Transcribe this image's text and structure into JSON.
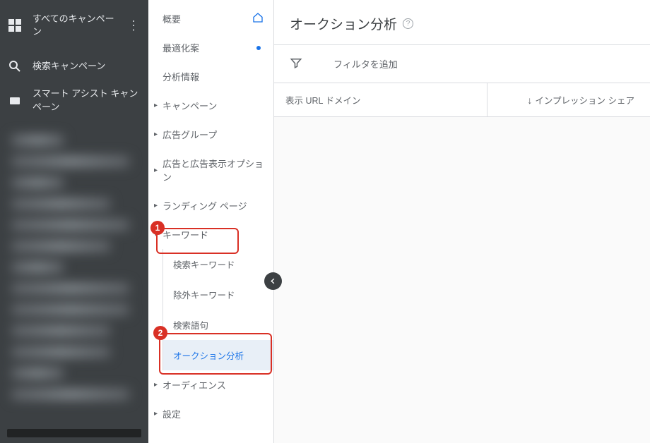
{
  "darkSidebar": {
    "allCampaigns": "すべてのキャンペーン",
    "searchCampaign": "検索キャンペーン",
    "smartAssist": "スマート アシスト キャンペーン"
  },
  "nav": {
    "overview": "概要",
    "optimization": "最適化案",
    "insights": "分析情報",
    "campaign": "キャンペーン",
    "adGroup": "広告グループ",
    "adsExt": "広告と広告表示オプション",
    "landing": "ランディング ページ",
    "keywords": "キーワード",
    "sub": {
      "searchKw": "検索キーワード",
      "negKw": "除外キーワード",
      "searchTerms": "検索語句",
      "auction": "オークション分析"
    },
    "audience": "オーディエンス",
    "settings": "設定"
  },
  "main": {
    "title": "オークション分析",
    "filterPlaceholder": "フィルタを追加",
    "col1": "表示 URL ドメイン",
    "col2": "インプレッション シェア"
  },
  "callouts": {
    "one": "1",
    "two": "2"
  }
}
